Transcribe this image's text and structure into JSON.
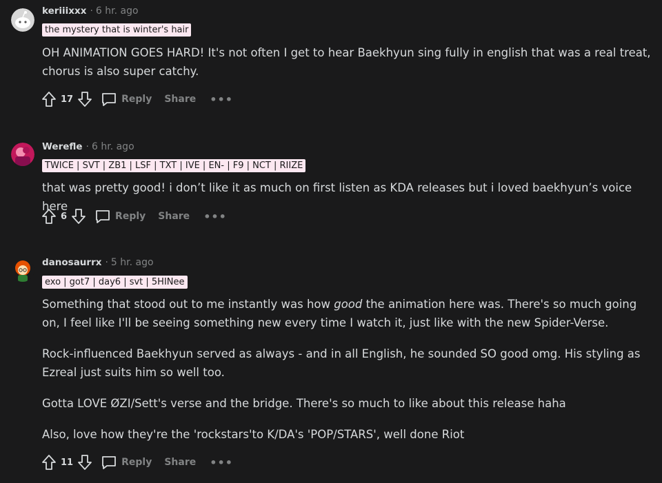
{
  "comments": [
    {
      "username": "keriiixxx",
      "time": "6 hr. ago",
      "flair": "the mystery that is winter's hair",
      "paragraphs": [
        "OH ANIMATION GOES HARD! It's not often I get to hear Baekhyun sing fully in english that was a real treat, chorus is also super catchy."
      ],
      "votes": "17",
      "reply_label": "Reply",
      "share_label": "Share",
      "more_label": "•••"
    },
    {
      "username": "Werefle",
      "time": "6 hr. ago",
      "flair": "TWICE | SVT | ZB1 | LSF | TXT | IVE | EN- | F9 | NCT | RIIZE",
      "paragraphs": [
        "that was pretty good! i don’t like it as much on first listen as KDA releases but i loved baekhyun’s voice here"
      ],
      "votes": "6",
      "reply_label": "Reply",
      "share_label": "Share",
      "more_label": "•••"
    },
    {
      "username": "danosaurrx",
      "time": "5 hr. ago",
      "flair": "exo | got7 | day6 | svt | 5HINee",
      "paragraph1_before": "Something that stood out to me instantly was how ",
      "paragraph1_em": "good",
      "paragraph1_after": " the animation here was. There's so much going on, I feel like I'll be seeing something new every time I watch it, just like with the new Spider-Verse.",
      "paragraphs": [
        "Rock-influenced Baekhyun served as always - and in all English, he sounded SO good omg. His styling as Ezreal just suits him so well too.",
        "Gotta LOVE ØZI/Sett's verse and the bridge. There's so much to like about this release haha",
        "Also, love how they're the 'rockstars'to K/DA's 'POP/STARS', well done Riot"
      ],
      "votes": "11",
      "reply_label": "Reply",
      "share_label": "Share",
      "more_label": "•••"
    }
  ],
  "colors": {
    "background": "#1a1a1b",
    "text": "#d7dadc",
    "muted": "#818384",
    "flair_bg": "#fce8f1"
  }
}
